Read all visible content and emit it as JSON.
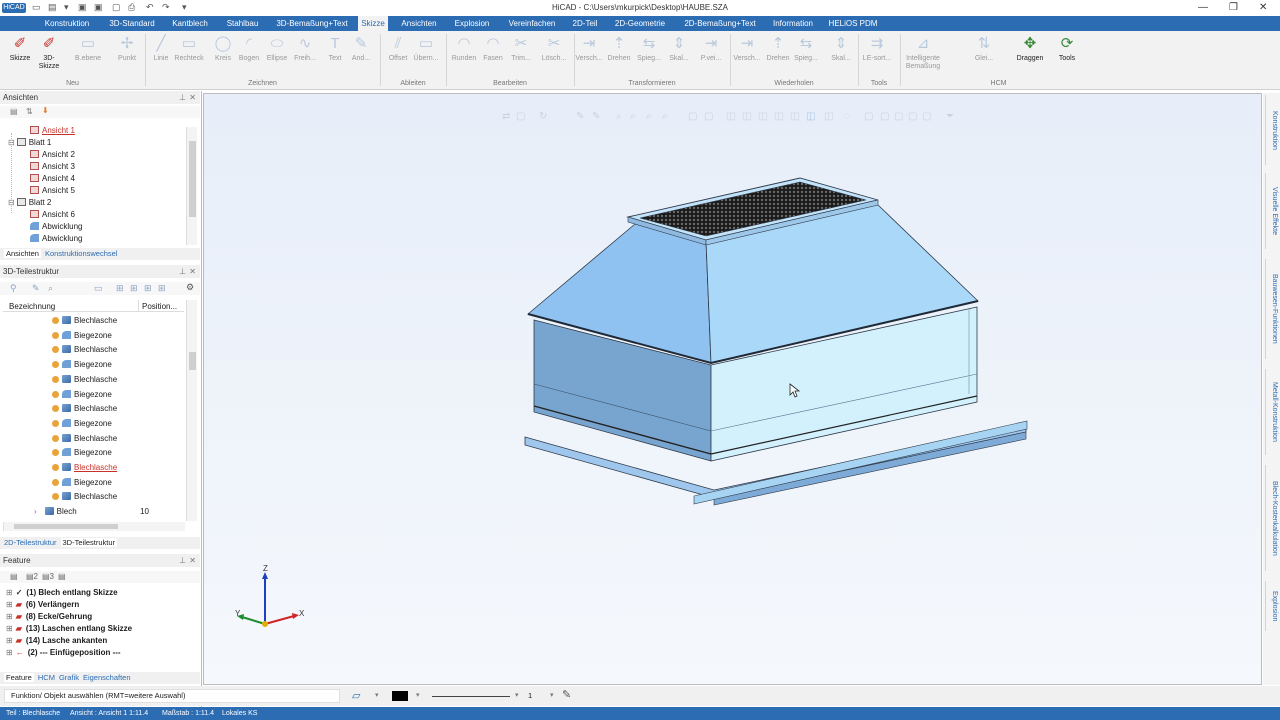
{
  "window": {
    "title": "HiCAD - C:\\Users\\mkurpick\\Desktop\\HAUBE.SZA",
    "app_badge": "HiCAD"
  },
  "menu_tabs": [
    "Konstruktion",
    "3D-Standard",
    "Kantblech",
    "Stahlbau",
    "3D-Bemaßung+Text",
    "Skizze",
    "Ansichten",
    "Explosion",
    "Vereinfachen",
    "2D-Teil",
    "2D-Geometrie",
    "2D-Bemaßung+Text",
    "Information",
    "HELiOS PDM"
  ],
  "active_tab": "Skizze",
  "ribbon": {
    "buttons": [
      "Skizze",
      "3D-Skizze",
      "B.ebene",
      "Punkt",
      "Linie",
      "Rechteck",
      "Kreis",
      "Bogen",
      "Ellipse",
      "Freih...",
      "Text",
      "And...",
      "Offset",
      "Übern...",
      "Runden",
      "Fasen",
      "Trim...",
      "Lösch...",
      "Versch...",
      "Drehen",
      "Spieg...",
      "Skal...",
      "P.vei...",
      "Versch...",
      "Drehen",
      "Spieg...",
      "Skal...",
      "LE-sort...",
      "Intelligente Bemaßung",
      "Glei...",
      "Draggen",
      "Tools"
    ],
    "groups": [
      "Neu",
      "Zeichnen",
      "Ableiten",
      "Bearbeiten",
      "Transformieren",
      "Wiederholen",
      "Tools",
      "HCM"
    ]
  },
  "ansichten_panel": {
    "title": "Ansichten",
    "items": [
      {
        "label": "Ansicht 1",
        "level": 2,
        "icon": "view-icon",
        "highlight": true
      },
      {
        "label": "Blatt 1",
        "level": 1,
        "icon": "sheet-icon",
        "highlight": false
      },
      {
        "label": "Ansicht 2",
        "level": 2,
        "icon": "view-icon",
        "highlight": false
      },
      {
        "label": "Ansicht 3",
        "level": 2,
        "icon": "view-icon",
        "highlight": false
      },
      {
        "label": "Ansicht 4",
        "level": 2,
        "icon": "view-icon",
        "highlight": false
      },
      {
        "label": "Ansicht 5",
        "level": 2,
        "icon": "view-icon",
        "highlight": false
      },
      {
        "label": "Blatt 2",
        "level": 1,
        "icon": "sheet-icon",
        "highlight": false
      },
      {
        "label": "Ansicht 6",
        "level": 2,
        "icon": "view-icon",
        "highlight": false
      },
      {
        "label": "Abwicklung",
        "level": 2,
        "icon": "unfold-icon",
        "highlight": false
      },
      {
        "label": "Abwicklung",
        "level": 2,
        "icon": "unfold-icon",
        "highlight": false
      }
    ],
    "tabs": [
      "Ansichten",
      "Konstruktionswechsel"
    ]
  },
  "teilestruktur_panel": {
    "title": "3D-Teilestruktur",
    "columns": [
      "Bezeichnung",
      "Position..."
    ],
    "rows": [
      {
        "label": "Blechlasche",
        "pos": "",
        "highlight": false
      },
      {
        "label": "Biegezone",
        "pos": "",
        "highlight": false
      },
      {
        "label": "Blechlasche",
        "pos": "",
        "highlight": false
      },
      {
        "label": "Biegezone",
        "pos": "",
        "highlight": false
      },
      {
        "label": "Blechlasche",
        "pos": "",
        "highlight": false
      },
      {
        "label": "Biegezone",
        "pos": "",
        "highlight": false
      },
      {
        "label": "Blechlasche",
        "pos": "",
        "highlight": false
      },
      {
        "label": "Biegezone",
        "pos": "",
        "highlight": false
      },
      {
        "label": "Blechlasche",
        "pos": "",
        "highlight": false
      },
      {
        "label": "Biegezone",
        "pos": "",
        "highlight": false
      },
      {
        "label": "Blechlasche",
        "pos": "",
        "highlight": true
      },
      {
        "label": "Biegezone",
        "pos": "",
        "highlight": false
      },
      {
        "label": "Blechlasche",
        "pos": "",
        "highlight": false
      },
      {
        "label": "Blech",
        "pos": "10",
        "highlight": false
      }
    ],
    "tabs": [
      "2D-Teilestruktur",
      "3D-Teilestruktur"
    ]
  },
  "feature_panel": {
    "title": "Feature",
    "items": [
      "(1) Blech entlang Skizze",
      "(6) Verlängern",
      "(8) Ecke/Gehrung",
      "(13) Laschen entlang Skizze",
      "(14) Lasche ankanten",
      "(2) --- Einfügeposition ---"
    ],
    "tabs": [
      "Feature",
      "HCM",
      "Grafik",
      "Eigenschaften"
    ]
  },
  "side_tabs": [
    "Konstruktion",
    "Visuelle Effekte",
    "Bauwesen-Funktionen",
    "Metall-Konstruktion",
    "Blech-Kostenkalkulation",
    "Explosion"
  ],
  "axes": {
    "x": "X",
    "y": "Y",
    "z": "Z"
  },
  "command_line": {
    "prompt": "Funktion/ Objekt auswählen (RMT=weitere Auswahl)",
    "line_width": "1"
  },
  "status_bar": {
    "part": "Teil : Blechlasche",
    "view": "Ansicht : Ansicht 1  1:11.4",
    "scale": "Maßstab : 1:11.4",
    "coord": "Lokales KS"
  },
  "colors": {
    "accent": "#2b6cb3",
    "model_light": "#c7ecfb",
    "model_dark": "#6b98c8"
  }
}
